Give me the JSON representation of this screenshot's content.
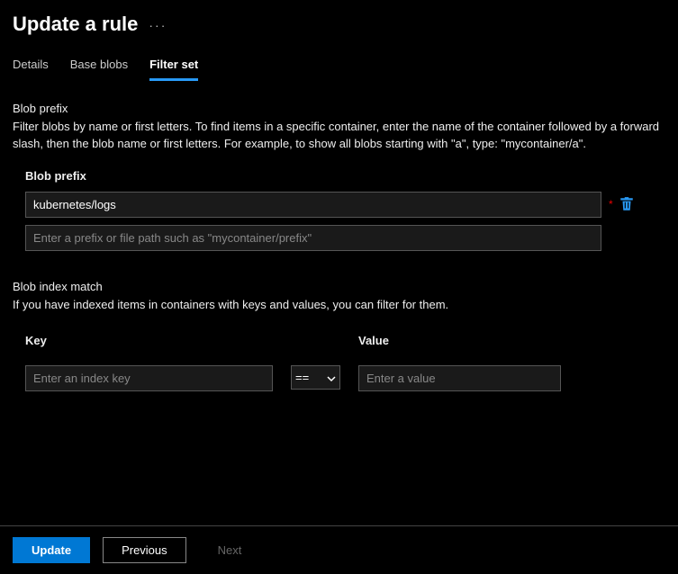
{
  "header": {
    "title": "Update a rule"
  },
  "tabs": {
    "details": "Details",
    "base_blobs": "Base blobs",
    "filter_set": "Filter set"
  },
  "blob_prefix_section": {
    "heading": "Blob prefix",
    "description": "Filter blobs by name or first letters. To find items in a specific container, enter the name of the container followed by a forward slash, then the blob name or first letters. For example, to show all blobs starting with \"a\", type: \"mycontainer/a\".",
    "field_label": "Blob prefix",
    "value": "kubernetes/logs",
    "placeholder": "Enter a prefix or file path such as \"mycontainer/prefix\""
  },
  "blob_index_section": {
    "heading": "Blob index match",
    "description": "If you have indexed items in containers with keys and values, you can filter for them.",
    "key_label": "Key",
    "value_label": "Value",
    "key_placeholder": "Enter an index key",
    "value_placeholder": "Enter a value",
    "operator": "=="
  },
  "footer": {
    "update": "Update",
    "previous": "Previous",
    "next": "Next"
  }
}
